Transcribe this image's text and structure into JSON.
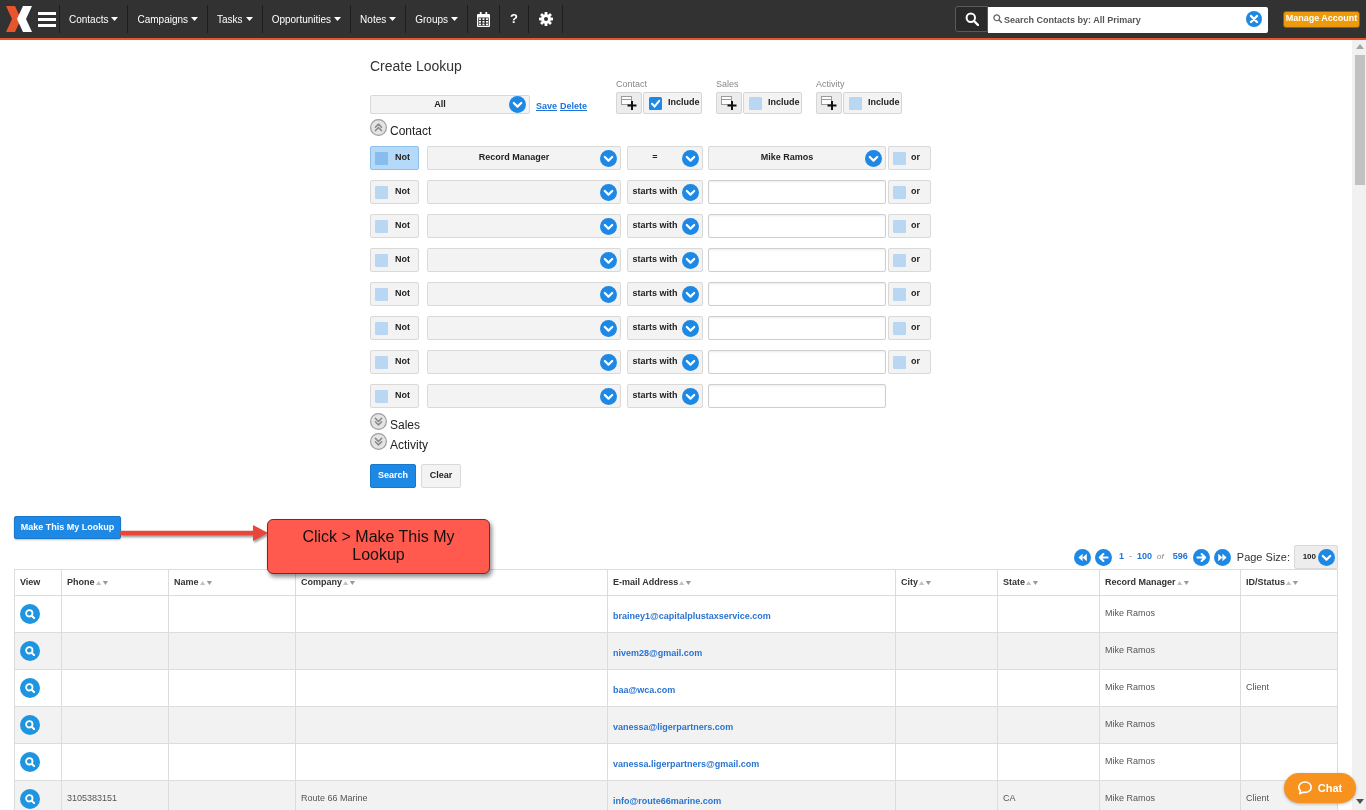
{
  "nav": {
    "menus": [
      {
        "label": "Contacts"
      },
      {
        "label": "Campaigns"
      },
      {
        "label": "Tasks"
      },
      {
        "label": "Opportunities"
      },
      {
        "label": "Notes"
      },
      {
        "label": "Groups"
      }
    ],
    "help": "?",
    "search": {
      "placeholder": "Search Contacts by: All Primary"
    },
    "manage_account": "Manage Account"
  },
  "lookup": {
    "title": "Create Lookup",
    "saved_lookup": "All",
    "links": [
      "Save",
      "Delete"
    ],
    "include_groups": [
      {
        "label": "Contact",
        "include_label": "Include",
        "checked": true
      },
      {
        "label": "Sales",
        "include_label": "Include",
        "checked": false
      },
      {
        "label": "Activity",
        "include_label": "Include",
        "checked": false
      }
    ],
    "sections": [
      {
        "label": "Contact",
        "expanded": true,
        "criteria": [
          {
            "not": {
              "label": "Not",
              "checked": false,
              "highlighted": true
            },
            "field": "Record Manager",
            "operator": "=",
            "kind": "select",
            "value": "Mike Ramos",
            "or": {
              "label": "or",
              "checked": false
            }
          },
          {
            "not": {
              "label": "Not",
              "checked": false,
              "highlighted": false
            },
            "operator": "starts with",
            "kind": "text",
            "or": {
              "label": "or",
              "checked": false
            }
          },
          {
            "not": {
              "label": "Not",
              "checked": false,
              "highlighted": false
            },
            "operator": "starts with",
            "kind": "text",
            "or": {
              "label": "or",
              "checked": false
            }
          },
          {
            "not": {
              "label": "Not",
              "checked": false,
              "highlighted": false
            },
            "operator": "starts with",
            "kind": "text",
            "or": {
              "label": "or",
              "checked": false
            }
          },
          {
            "not": {
              "label": "Not",
              "checked": false,
              "highlighted": false
            },
            "operator": "starts with",
            "kind": "text",
            "or": {
              "label": "or",
              "checked": false
            }
          },
          {
            "not": {
              "label": "Not",
              "checked": false,
              "highlighted": false
            },
            "operator": "starts with",
            "kind": "text",
            "or": {
              "label": "or",
              "checked": false
            }
          },
          {
            "not": {
              "label": "Not",
              "checked": false,
              "highlighted": false
            },
            "operator": "starts with",
            "kind": "text",
            "or": {
              "label": "or",
              "checked": false
            }
          },
          {
            "not": {
              "label": "Not",
              "checked": false,
              "highlighted": false
            },
            "operator": "starts with",
            "kind": "text"
          }
        ]
      },
      {
        "label": "Sales",
        "expanded": false
      },
      {
        "label": "Activity",
        "expanded": false
      }
    ],
    "buttons": [
      {
        "label": "Search",
        "kind": "primary"
      },
      {
        "label": "Clear",
        "kind": "secondary"
      }
    ]
  },
  "make_lookup_button": "Make This My Lookup",
  "annotation": {
    "text": "Click > Make This My Lookup"
  },
  "pagination": {
    "from": "1",
    "separator": "-",
    "to": "100",
    "of": "of",
    "total": "596",
    "page_size_label": "Page Size:",
    "page_size": "100"
  },
  "table": {
    "columns": [
      {
        "label": "View",
        "sortable": false
      },
      {
        "label": "Phone",
        "sortable": true
      },
      {
        "label": "Name",
        "sortable": true
      },
      {
        "label": "Company",
        "sortable": true
      },
      {
        "label": "E-mail Address",
        "sortable": true
      },
      {
        "label": "City",
        "sortable": true
      },
      {
        "label": "State",
        "sortable": true
      },
      {
        "label": "Record Manager",
        "sortable": true
      },
      {
        "label": "ID/Status",
        "sortable": true
      }
    ],
    "rows": [
      {
        "email": "brainey1@capitalplustaxservice.com",
        "record_manager": "Mike Ramos"
      },
      {
        "email": "nivem28@gmail.com",
        "record_manager": "Mike Ramos"
      },
      {
        "email": "baa@wca.com",
        "record_manager": "Mike Ramos",
        "id_status": "Client"
      },
      {
        "email": "vanessa@ligerpartners.com",
        "record_manager": "Mike Ramos"
      },
      {
        "email": "vanessa.ligerpartners@gmail.com",
        "record_manager": "Mike Ramos"
      },
      {
        "phone": "3105383151",
        "company": "Route 66 Marine",
        "email": "info@route66marine.com",
        "state": "CA",
        "record_manager": "Mike Ramos",
        "id_status": "Client"
      }
    ]
  },
  "chat": {
    "label": "Chat"
  }
}
